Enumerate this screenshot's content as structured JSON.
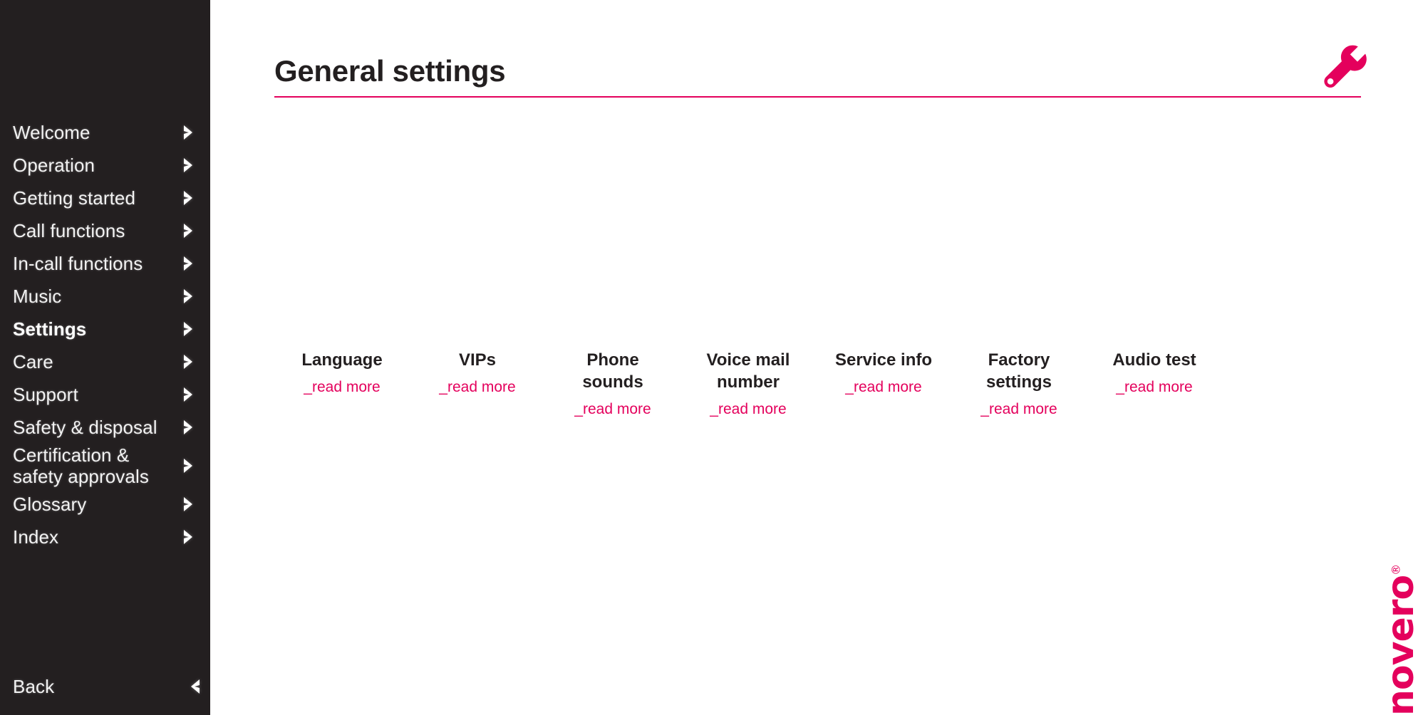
{
  "sidebar": {
    "items": [
      {
        "label": "Welcome",
        "icon": "chevron-right-icon",
        "active": false,
        "two_line": false
      },
      {
        "label": "Operation",
        "icon": "chevron-right-icon",
        "active": false,
        "two_line": false
      },
      {
        "label": "Getting started",
        "icon": "chevron-right-icon",
        "active": false,
        "two_line": false
      },
      {
        "label": "Call functions",
        "icon": "chevron-right-icon",
        "active": false,
        "two_line": false
      },
      {
        "label": "In-call functions",
        "icon": "chevron-right-icon",
        "active": false,
        "two_line": false
      },
      {
        "label": "Music",
        "icon": "chevron-right-icon",
        "active": false,
        "two_line": false
      },
      {
        "label": "Settings",
        "icon": "chevron-right-icon",
        "active": true,
        "two_line": false
      },
      {
        "label": "Care",
        "icon": "chevron-right-icon",
        "active": false,
        "two_line": false
      },
      {
        "label": "Support",
        "icon": "chevron-right-icon",
        "active": false,
        "two_line": false
      },
      {
        "label": "Safety & disposal",
        "icon": "chevron-right-icon",
        "active": false,
        "two_line": false
      },
      {
        "label": "Certification &\nsafety approvals",
        "icon": "chevron-right-icon",
        "active": false,
        "two_line": true
      },
      {
        "label": "Glossary",
        "icon": "chevron-right-icon",
        "active": false,
        "two_line": false
      },
      {
        "label": "Index",
        "icon": "chevron-right-icon",
        "active": false,
        "two_line": false
      }
    ],
    "back": {
      "label": "Back",
      "icon": "chevron-left-icon"
    },
    "background_color": "#231f20",
    "text_color": "#f2f2f2"
  },
  "header": {
    "title": "General settings",
    "icon": "wrench-icon",
    "accent_color": "#e4005c",
    "title_color": "#231f20"
  },
  "main": {
    "cards": [
      {
        "title": "Language",
        "link_label": "_read more"
      },
      {
        "title": "VIPs",
        "link_label": "_read more"
      },
      {
        "title": "Phone\nsounds",
        "link_label": "_read more"
      },
      {
        "title": "Voice mail\nnumber",
        "link_label": "_read more"
      },
      {
        "title": "Service info",
        "link_label": "_read more"
      },
      {
        "title": "Factory\nsettings",
        "link_label": "_read more"
      },
      {
        "title": "Audio test",
        "link_label": "_read more"
      }
    ]
  },
  "brand": {
    "name": "novero",
    "registered_mark": "®",
    "color": "#e4005c"
  }
}
